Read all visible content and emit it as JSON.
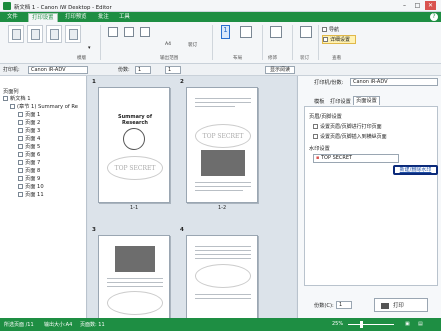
{
  "window": {
    "title": "新文档 1 - Canon iW Desktop - Editor"
  },
  "ribbon_tabs": [
    "文件",
    "打印设置",
    "打印预览",
    "批注",
    "工具"
  ],
  "ribbon": {
    "groups": [
      "模版",
      "输出范围",
      "布局",
      "修饰",
      "装订",
      "查看"
    ],
    "buttons": {
      "a4": "A4",
      "binding": "装订",
      "show_panel_1": "导航",
      "show_panel_2": "详细设置",
      "layout_count": "1"
    }
  },
  "toolbar": {
    "printer_label": "打印机:",
    "printer_value": "Canon iR-ADV",
    "copies_label": "份数:",
    "copies_value": "1",
    "page_label": "1",
    "zoom_button": "显示阅读"
  },
  "tree": {
    "header": "页面列",
    "root": "新文档 1",
    "doc": "(章节 1) Summary of Re",
    "pages": [
      "页面 1",
      "页面 2",
      "页面 3",
      "页面 4",
      "页面 5",
      "页面 6",
      "页面 7",
      "页面 8",
      "页面 9",
      "页面 10",
      "页面 11"
    ]
  },
  "center": {
    "sheet_numbers": [
      "1",
      "2",
      "3",
      "4"
    ],
    "captions": [
      "1-1",
      "1-2"
    ],
    "page1_heading": "Summary of Research",
    "stamp": "TOP SECRET"
  },
  "right": {
    "printer_label": "打印机/份数:",
    "printer_value": "Canon iR-ADV",
    "tabs": [
      "模板",
      "打印设置",
      "页面设置"
    ],
    "section_title": "页眉/页脚设置",
    "checkbox1": "设置页眉/页脚进行打印页面",
    "checkbox2": "设置页眉/页脚插入到横纵页面",
    "watermark_label": "水印设置",
    "watermark_value": "TOP SECRET",
    "link": "新建/删除水印",
    "copies_label": "份数(C):",
    "copies_value": "1",
    "print_button": "打印"
  },
  "status": {
    "pages": "所选页面 /11",
    "size": "输出大小:A4",
    "count": "页面数: 11",
    "zoom": "25%"
  },
  "colors": {
    "accent": "#1e8e43",
    "link": "#1f4fa6",
    "highlight": "#0b2a7a"
  }
}
